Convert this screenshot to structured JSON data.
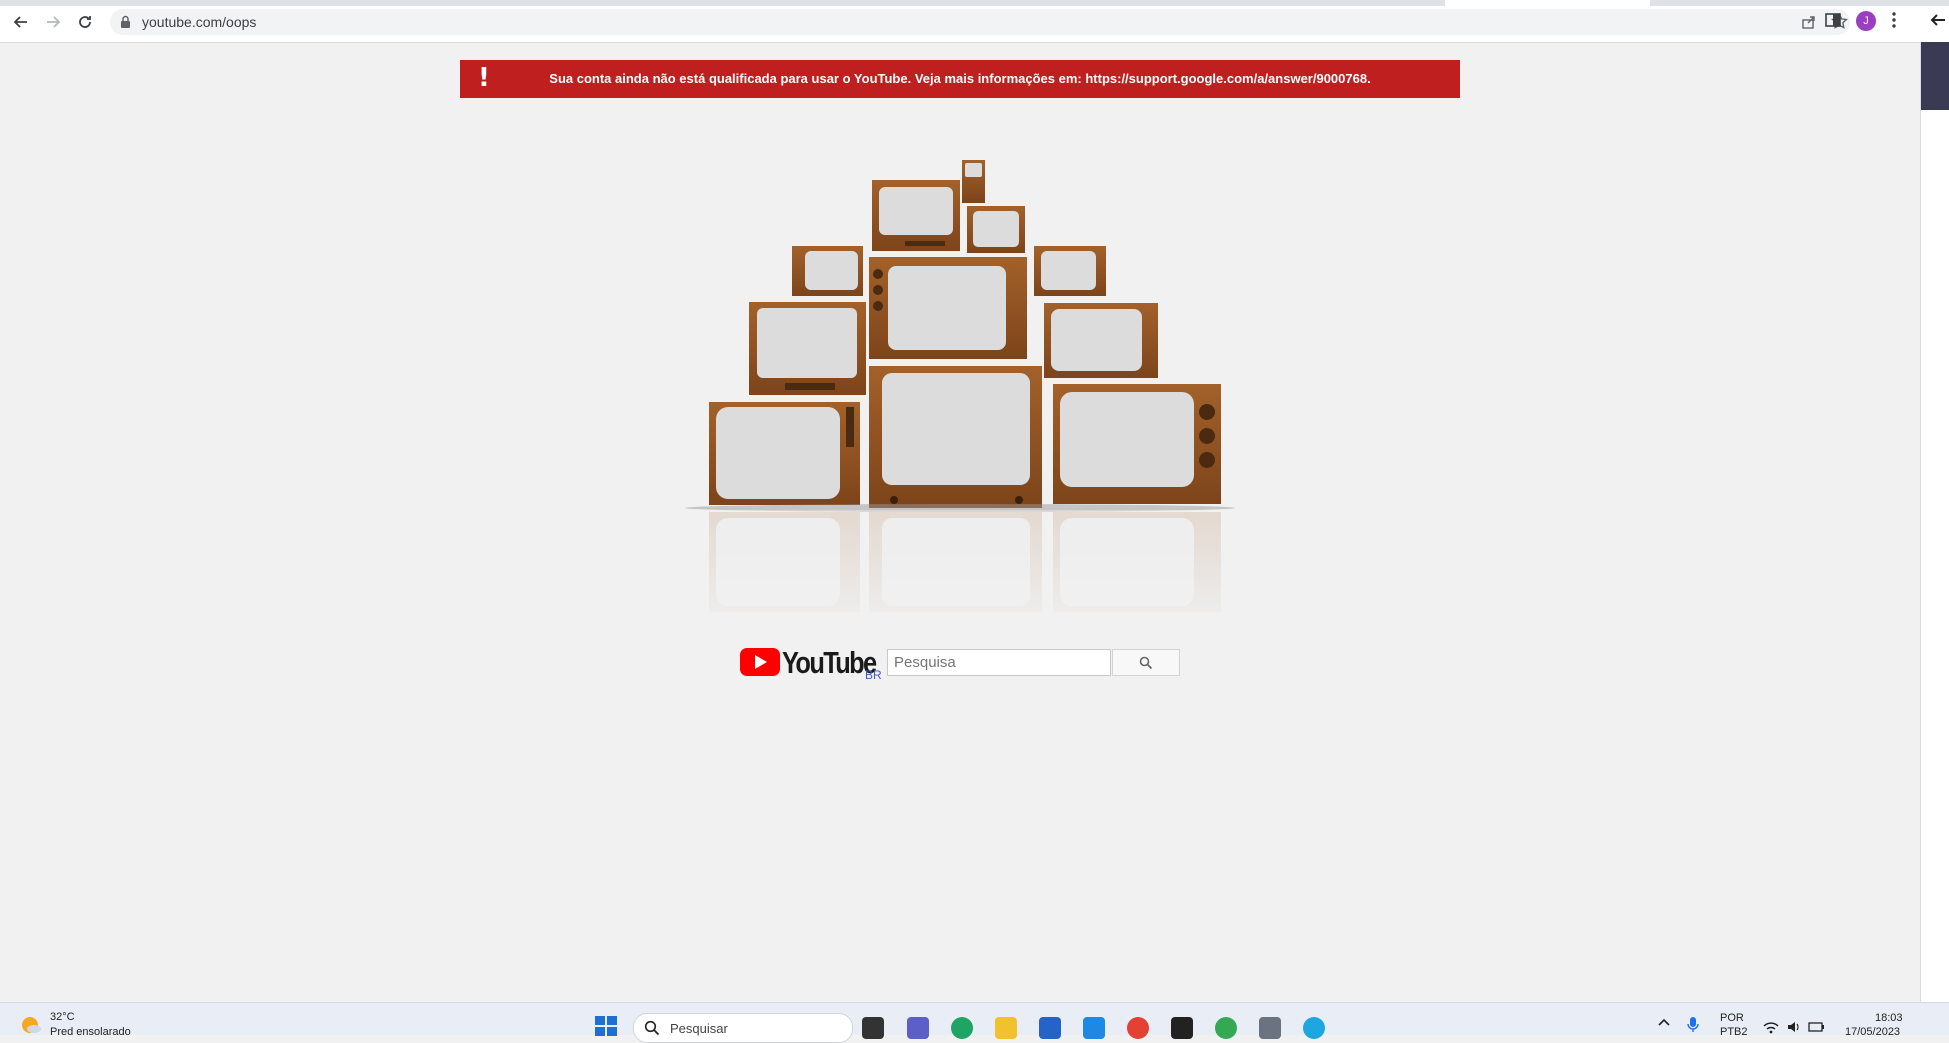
{
  "browser": {
    "url": "youtube.com/oops",
    "profile_initial": "J"
  },
  "banner": {
    "icon": "!",
    "message": "Sua conta ainda não está qualificada para usar o YouTube. Veja mais informações em: https://support.google.com/a/answer/9000768."
  },
  "footer": {
    "logo_text": "YouTube",
    "country": "BR",
    "search_placeholder": "Pesquisa"
  },
  "taskbar": {
    "temperature": "32°C",
    "weather": "Pred ensolarado",
    "search_label": "Pesquisar",
    "lang_line1": "POR",
    "lang_line2": "PTB2",
    "time": "18:03",
    "date": "17/05/2023"
  },
  "colors": {
    "banner_bg": "#c01f1f",
    "page_bg": "#f1f1f1",
    "youtube_red": "#ff0000"
  }
}
